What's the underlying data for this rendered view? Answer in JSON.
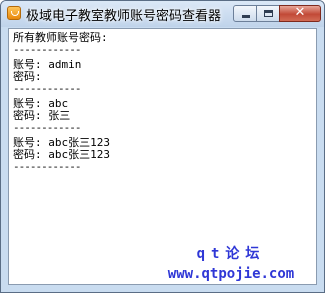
{
  "window": {
    "title": "极域电子教室教师账号密码查看器",
    "icon": "app-icon",
    "controls": {
      "minimize": "minimize-icon",
      "maximize": "maximize-icon",
      "close_glyph": "✕"
    }
  },
  "output": {
    "header": "所有教师账号密码:",
    "separator": "------------",
    "accounts": [
      {
        "account_line": "账号: admin",
        "password_line": "密码:"
      },
      {
        "account_line": "账号: abc",
        "password_line": "密码: 张三"
      },
      {
        "account_line": "账号: abc张三123",
        "password_line": "密码: abc张三123"
      }
    ]
  },
  "watermark": {
    "line1": "qt论坛",
    "line2": "www.qtpojie.com",
    "color": "#2f37d6"
  }
}
